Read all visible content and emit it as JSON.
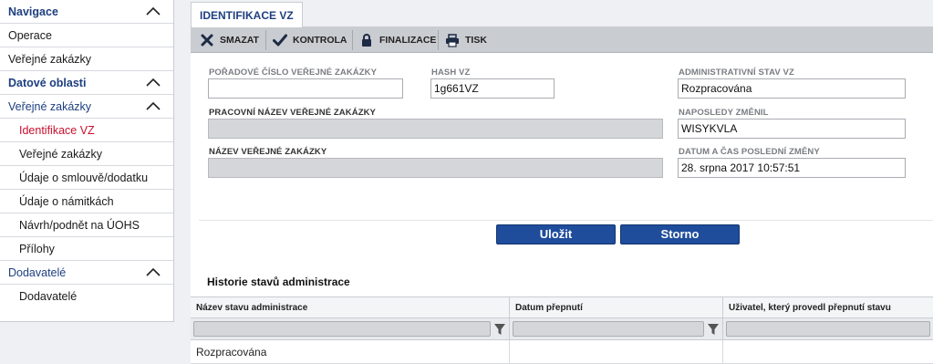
{
  "sidebar": {
    "items": [
      {
        "label": "Navigace"
      },
      {
        "label": "Operace"
      },
      {
        "label": "Veřejné zakázky"
      },
      {
        "label": "Datové oblasti"
      },
      {
        "label": "Veřejné zakázky"
      },
      {
        "label": "Identifikace VZ"
      },
      {
        "label": "Veřejné zakázky"
      },
      {
        "label": "Údaje o smlouvě/dodatku"
      },
      {
        "label": "Údaje o námitkách"
      },
      {
        "label": "Návrh/podnět na ÚOHS"
      },
      {
        "label": "Přílohy"
      },
      {
        "label": "Dodavatelé"
      },
      {
        "label": "Dodavatelé"
      }
    ]
  },
  "tab": {
    "label": "IDENTIFIKACE VZ"
  },
  "toolbar": {
    "delete": "SMAZAT",
    "check": "KONTROLA",
    "finalize": "FINALIZACE",
    "print": "TISK"
  },
  "form": {
    "order_number_label": "POŘADOVÉ ČÍSLO VEŘEJNÉ ZAKÁZKY",
    "order_number_value": "",
    "hash_label": "HASH VZ",
    "hash_value": "1g661VZ",
    "admin_state_label": "ADMINISTRATIVNÍ STAV VZ",
    "admin_state_value": "Rozpracována",
    "working_name_label": "PRACOVNÍ NÁZEV VEŘEJNÉ ZAKÁZKY",
    "last_changed_by_label": "NAPOSLEDY ZMĚNIL",
    "last_changed_by_value": "WISYKVLA",
    "name_label": "NÁZEV VEŘEJNÉ ZAKÁZKY",
    "last_change_label": "DATUM A ČAS POSLEDNÍ ZMĚNY",
    "last_change_value": "28. srpna 2017 10:57:51"
  },
  "buttons": {
    "save": "Uložit",
    "cancel": "Storno"
  },
  "history": {
    "title": "Historie stavů administrace",
    "columns": [
      "Název stavu administrace",
      "Datum přepnutí",
      "Uživatel, který provedl přepnutí stavu"
    ],
    "rows": [
      [
        "Rozpracována",
        "",
        ""
      ]
    ]
  },
  "colors": {
    "accent": "#1e3f80",
    "active": "#c8102e",
    "button": "#1f4d9c"
  }
}
